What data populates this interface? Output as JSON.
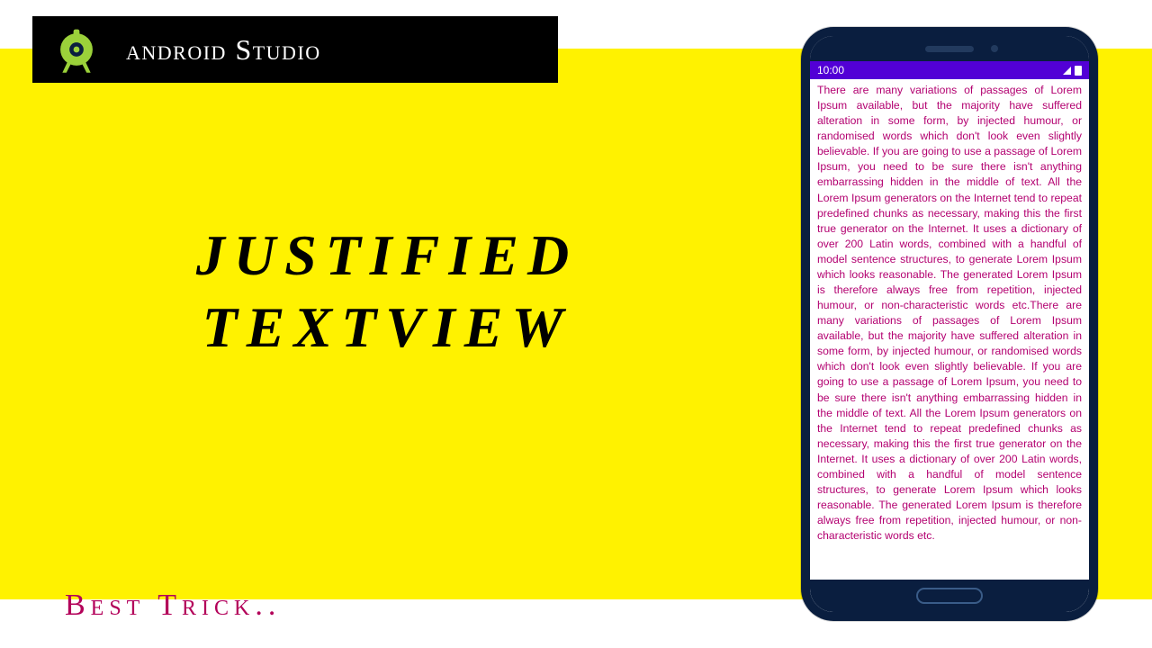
{
  "header": {
    "title": "android Studio"
  },
  "main": {
    "title_line1": "JUSTIFIED",
    "title_line2": "TEXTVIEW"
  },
  "footer": {
    "subtitle": "Best Trick.."
  },
  "phone": {
    "status_time": "10:00",
    "body_text": "There are many variations of passages of Lorem Ipsum available, but the majority have suffered alteration in some form, by injected humour, or randomised words which don't look even slightly believable. If you are going to use a passage of Lorem Ipsum, you need to be sure there isn't anything embarrassing hidden in the middle of text. All the Lorem Ipsum generators on the Internet tend to repeat predefined chunks as necessary, making this the first true generator on the Internet. It uses a dictionary of over 200 Latin words, combined with a handful of model sentence structures, to generate Lorem Ipsum which looks reasonable. The generated Lorem Ipsum is therefore always free from repetition, injected humour, or non-characteristic words etc.There are many variations of passages of Lorem Ipsum available, but the majority have suffered alteration in some form, by injected humour, or randomised words which don't look even slightly believable. If you are going to use a passage of Lorem Ipsum, you need to be sure there isn't anything embarrassing hidden in the middle of text. All the Lorem Ipsum generators on the Internet tend to repeat predefined chunks as necessary, making this the first true generator on the Internet. It uses a dictionary of over 200 Latin words, combined with a handful of model sentence structures, to generate Lorem Ipsum which looks reasonable. The generated Lorem Ipsum is therefore always free from repetition, injected humour, or non-characteristic words etc."
  },
  "colors": {
    "background": "#fff200",
    "accent": "#b30059",
    "phone_text": "#b30070",
    "statusbar": "#5200d6"
  }
}
